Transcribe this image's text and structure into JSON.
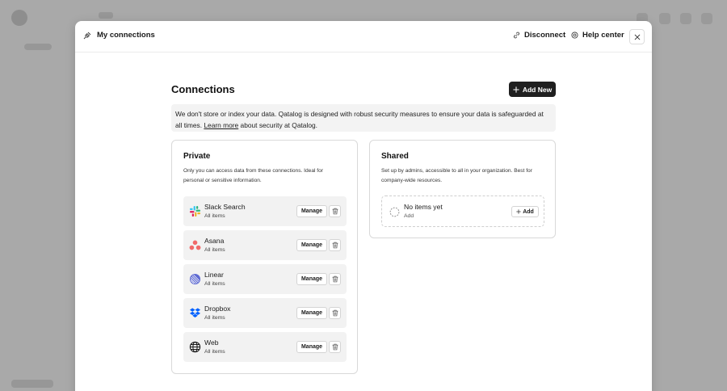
{
  "header": {
    "title": "My connections",
    "disconnect_label": "Disconnect",
    "help_label": "Help center"
  },
  "main": {
    "title": "Connections",
    "add_new_label": "Add New",
    "notice": {
      "text": "We don't store or index your data. Qatalog is designed with robust security measures to ensure your data is safeguarded at all times.",
      "link": "Learn more",
      "suffix": "about security at Qatalog."
    }
  },
  "private": {
    "title": "Private",
    "description": "Only you can access data from these connections. Ideal for personal or sensitive information.",
    "manage_label": "Manage",
    "items": [
      {
        "name": "Slack Search",
        "sub": "All items",
        "icon": "slack-icon"
      },
      {
        "name": "Asana",
        "sub": "All items",
        "icon": "asana-icon"
      },
      {
        "name": "Linear",
        "sub": "All items",
        "icon": "linear-icon"
      },
      {
        "name": "Dropbox",
        "sub": "All items",
        "icon": "dropbox-icon"
      },
      {
        "name": "Web",
        "sub": "All items",
        "icon": "globe-icon"
      }
    ]
  },
  "shared": {
    "title": "Shared",
    "description": "Set up by admins, accessible to all in your organization. Best for company-wide resources.",
    "empty_title": "No items yet",
    "empty_sub": "Add",
    "add_label": "Add"
  },
  "colors": {
    "overlay": "#a9a9a9",
    "primary_button": "#1f1f1f",
    "slack_green": "#2eb67d",
    "slack_blue": "#36c5f0",
    "slack_red": "#e01e5a",
    "slack_yellow": "#ecb22e",
    "asana": "#f06a6a",
    "linear": "#5e6ad2",
    "dropbox": "#0061ff"
  }
}
